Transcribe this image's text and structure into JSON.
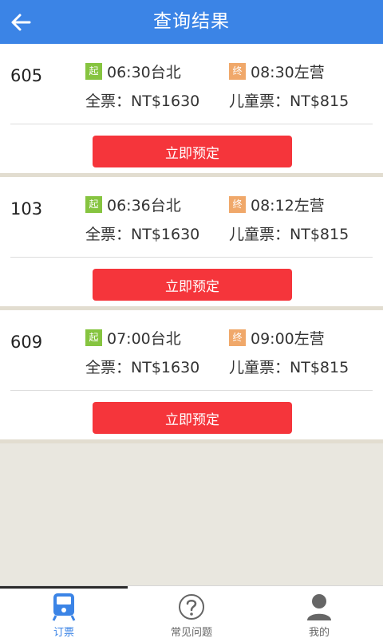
{
  "header": {
    "title": "查询结果",
    "back_icon": "arrow-left-icon"
  },
  "trains": [
    {
      "number": "605",
      "depart_badge": "起",
      "depart": "06:30台北",
      "arrive_badge": "终",
      "arrive": "08:30左营",
      "full_fare": "全票：NT$1630",
      "child_fare": "儿童票：NT$815",
      "book_label": "立即预定"
    },
    {
      "number": "103",
      "depart_badge": "起",
      "depart": "06:36台北",
      "arrive_badge": "终",
      "arrive": "08:12左营",
      "full_fare": "全票：NT$1630",
      "child_fare": "儿童票：NT$815",
      "book_label": "立即预定"
    },
    {
      "number": "609",
      "depart_badge": "起",
      "depart": "07:00台北",
      "arrive_badge": "终",
      "arrive": "09:00左营",
      "full_fare": "全票：NT$1630",
      "child_fare": "儿童票：NT$815",
      "book_label": "立即预定"
    }
  ],
  "tabbar": {
    "items": [
      {
        "label": "订票",
        "icon": "train-icon",
        "active": true
      },
      {
        "label": "常见问题",
        "icon": "question-icon",
        "active": false
      },
      {
        "label": "我的",
        "icon": "user-icon",
        "active": false
      }
    ]
  },
  "colors": {
    "primary": "#3b84e6",
    "button": "#f5353b",
    "start_badge": "#86c440",
    "end_badge": "#f0a86a"
  }
}
